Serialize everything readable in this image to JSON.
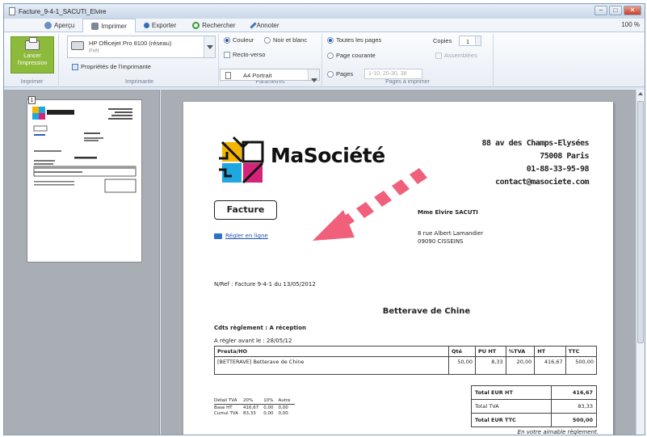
{
  "window": {
    "title": "Facture_9-4-1_SACUTI_Elvire"
  },
  "tabs": [
    {
      "label": "Aperçu"
    },
    {
      "label": "Imprimer"
    },
    {
      "label": "Exporter"
    },
    {
      "label": "Rechercher"
    },
    {
      "label": "Annoter"
    }
  ],
  "zoom": "100 %",
  "ribbon": {
    "print_button": "Lancer l'impression",
    "printer_name": "HP Officejet Pro 8100 (réseau)",
    "printer_status": "Prêt",
    "printer_properties": "Propriétés de l'imprimante",
    "color_label": "Couleur",
    "bw_label": "Noir et blanc",
    "duplex_label": "Recto-verso",
    "format_value": "A4 Portrait",
    "all_pages": "Toutes les pages",
    "current_page": "Page courante",
    "pages_label": "Pages",
    "pages_placeholder": "1-10, 20-30, 38",
    "copies_label": "Copies",
    "copies_value": "1",
    "collate_label": "Assemblées",
    "groups": [
      "Imprimer",
      "Imprimante",
      "Paramètres",
      "Pages à imprimer"
    ]
  },
  "thumbnail": {
    "page_number": "1"
  },
  "invoice": {
    "company_name": "MaSociété",
    "address_line1": "88 av des Champs-Elysées",
    "address_line2": "75008 Paris",
    "phone": "01-88-33-95-98",
    "email": "contact@masociete.com",
    "doc_type": "Facture",
    "pay_online": "Régler en ligne",
    "client_name": "Mme Elvire SACUTI",
    "client_street": "8 rue Albert Lamandier",
    "client_city": "09090 CISSEINS",
    "reference": "N/Ref : Facture 9-4-1 du 13/05/2012",
    "title": "Betterave de Chine",
    "payment_terms": "Cdts règlement : A réception",
    "due_date": "A régler avant le : 28/05/12",
    "columns": [
      "Presta/HO",
      "Qté",
      "PU HT",
      "%TVA",
      "HT",
      "TTC"
    ],
    "rows": [
      [
        "[BETTERAVE] Betterave de Chine",
        "50,00",
        "8,33",
        "20,00",
        "416,67",
        "500,00"
      ]
    ],
    "vat_headers": [
      "Détail TVA",
      "20%",
      "10%",
      "Autre"
    ],
    "vat_rows": [
      [
        "Base HT",
        "416,67",
        "0,00",
        "0,00"
      ],
      [
        "Cumul TVA",
        "83,33",
        "0,00",
        "0,00"
      ]
    ],
    "totals": [
      [
        "Total EUR HT",
        "416,67"
      ],
      [
        "Total TVA",
        "83,33"
      ],
      [
        "Total EUR TTC",
        "500,00"
      ]
    ],
    "footer_note": "En votre aimable règlement."
  }
}
